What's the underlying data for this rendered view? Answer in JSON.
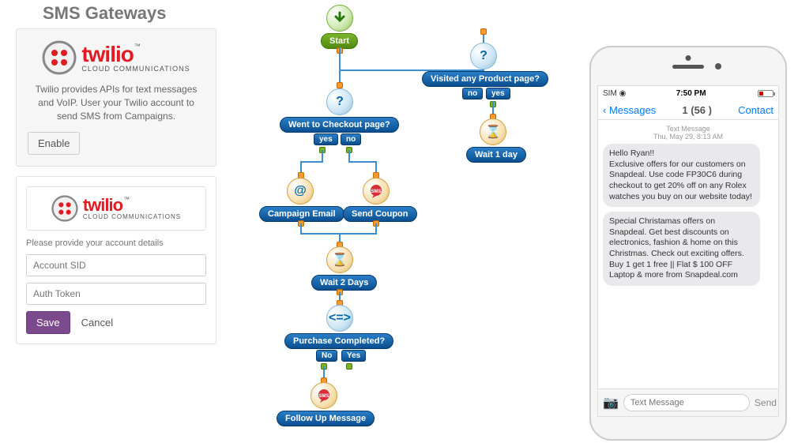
{
  "header": {
    "title": "SMS Gateways"
  },
  "twilio": {
    "word": "twilio",
    "tag": "CLOUD COMMUNICATIONS",
    "tm": "™"
  },
  "card1": {
    "desc": "Twilio provides APIs for text messages and VoIP. User your Twilio account to send SMS from Campaigns.",
    "enable": "Enable"
  },
  "card2": {
    "hint": "Please provide your account details",
    "sid_ph": "Account SID",
    "token_ph": "Auth Token",
    "save": "Save",
    "cancel": "Cancel"
  },
  "flow": {
    "start": "Start",
    "q1": "Went to Checkout page?",
    "q2": "Visited any Product page?",
    "yes": "yes",
    "no": "no",
    "No": "No",
    "Yes": "Yes",
    "wait1": "Wait 1 day",
    "email": "Campaign Email",
    "coupon": "Send Coupon",
    "wait2": "Wait 2 Days",
    "purchase": "Purchase Completed?",
    "follow": "Follow Up Message"
  },
  "phone": {
    "carrier": "SIM",
    "time": "7:50 PM",
    "back": "Messages",
    "title": "1 (56 )",
    "contact": "Contact",
    "meta1": "Text Message",
    "meta2": "Thu, May 29, 8:13 AM",
    "msg1": "Hello Ryan!!\nExclusive offers for our customers on Snapdeal. Use code FP30C6 during checkout to get 20% off on any Rolex watches you buy on our website today!",
    "msg2": "Special Christamas offers on Snapdeal. Get best discounts on electronics, fashion & home on this Christmas. Check out exciting offers. Buy 1 get 1 free || Flat $ 100 OFF Laptop & more from Snapdeal.com",
    "compose_ph": "Text Message",
    "send": "Send"
  }
}
